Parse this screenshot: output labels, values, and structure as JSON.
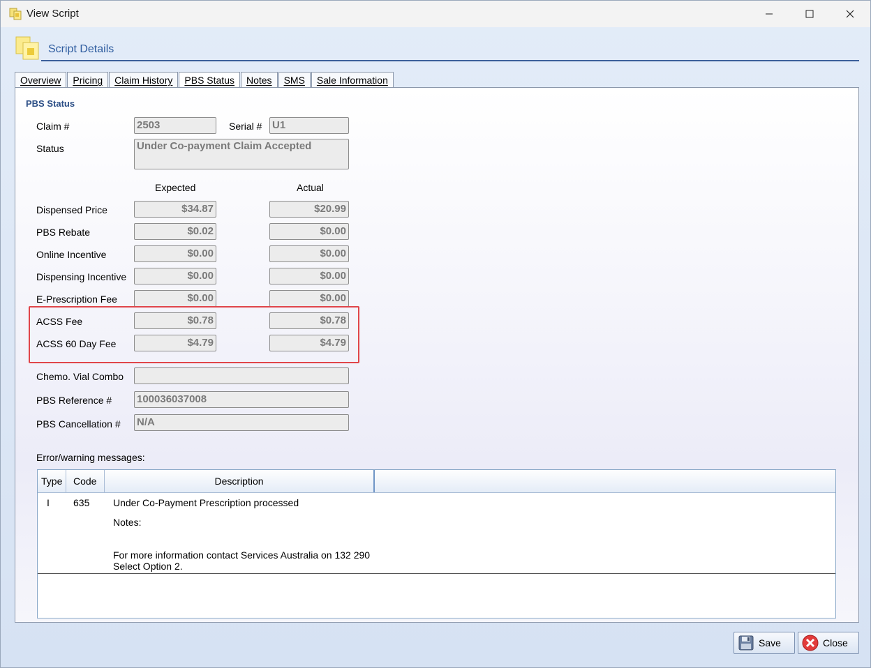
{
  "window": {
    "title": "View Script",
    "controls": {
      "minimize": "—",
      "maximize": "☐",
      "close": "✕"
    }
  },
  "header": {
    "title": "Script Details"
  },
  "tabs": [
    "Overview",
    "Pricing",
    "Claim History",
    "PBS Status",
    "Notes",
    "SMS",
    "Sale Information"
  ],
  "active_tab": "PBS Status",
  "pbs": {
    "section_title": "PBS Status",
    "claim_label": "Claim #",
    "claim_value": "2503",
    "serial_label": "Serial #",
    "serial_value": "U1",
    "status_label": "Status",
    "status_value": "Under Co-payment Claim Accepted",
    "col_expected": "Expected",
    "col_actual": "Actual",
    "rows": [
      {
        "label": "Dispensed Price",
        "expected": "$34.87",
        "actual": "$20.99"
      },
      {
        "label": "PBS Rebate",
        "expected": "$0.02",
        "actual": "$0.00"
      },
      {
        "label": "Online Incentive",
        "expected": "$0.00",
        "actual": "$0.00"
      },
      {
        "label": "Dispensing Incentive",
        "expected": "$0.00",
        "actual": "$0.00"
      },
      {
        "label": "E-Prescription Fee",
        "expected": "$0.00",
        "actual": "$0.00"
      },
      {
        "label": "ACSS Fee",
        "expected": "$0.78",
        "actual": "$0.78"
      },
      {
        "label": "ACSS 60 Day Fee",
        "expected": "$4.79",
        "actual": "$4.79"
      }
    ],
    "chemo_label": "Chemo. Vial Combo",
    "chemo_value": "",
    "ref_label": "PBS Reference #",
    "ref_value": "100036037008",
    "cancel_label": "PBS Cancellation #",
    "cancel_value": "N/A"
  },
  "messages": {
    "label": "Error/warning messages:",
    "columns": [
      "Type",
      "Code",
      "Description"
    ],
    "row": {
      "type": "I",
      "code": "635",
      "description": "Under Co-Payment Prescription processed",
      "notes": "Notes:",
      "info_line1": "For more information contact Services Australia on 132 290",
      "info_line2": "Select Option 2."
    }
  },
  "buttons": {
    "save": "Save",
    "close": "Close"
  },
  "colors": {
    "accent": "#2f5da0",
    "highlight_box": "#e0454a"
  }
}
